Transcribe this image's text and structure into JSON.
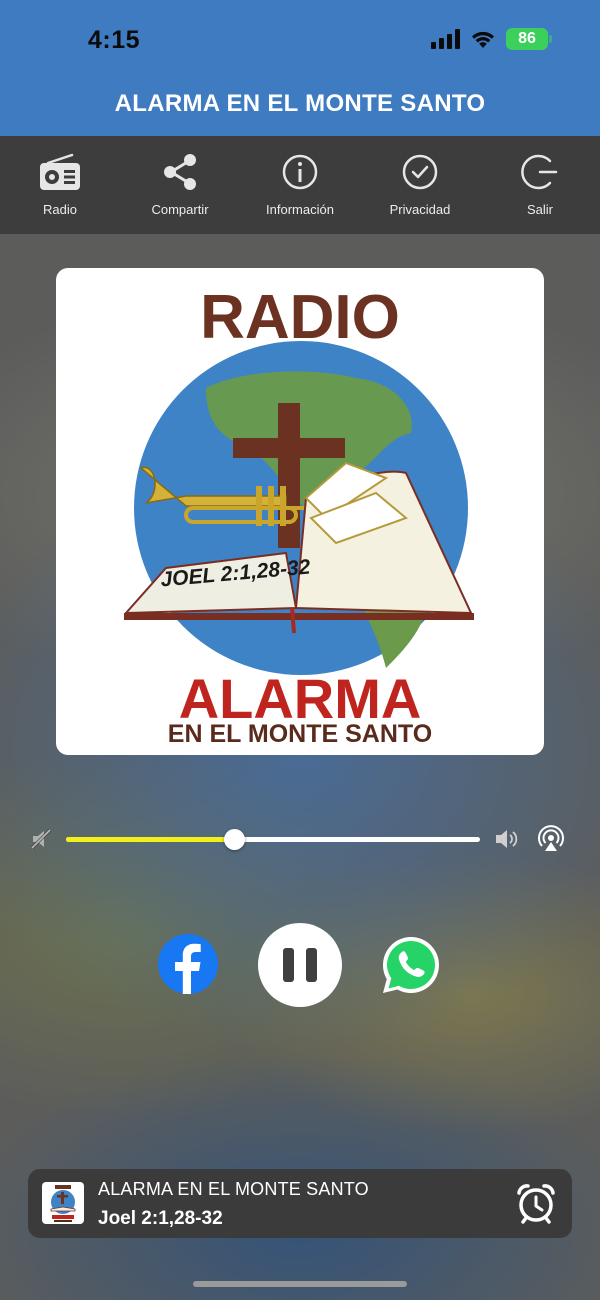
{
  "status_bar": {
    "time": "4:15",
    "battery": "86"
  },
  "app": {
    "title": "ALARMA EN EL MONTE SANTO"
  },
  "toolbar": {
    "items": [
      {
        "label": "Radio",
        "icon": "radio-icon"
      },
      {
        "label": "Compartir",
        "icon": "share-icon"
      },
      {
        "label": "Información",
        "icon": "info-icon"
      },
      {
        "label": "Privacidad",
        "icon": "check-circle-icon"
      },
      {
        "label": "Salir",
        "icon": "exit-icon"
      }
    ]
  },
  "artwork": {
    "top_text": "RADIO",
    "verse": "JOEL 2:1,28-32",
    "main_text": "ALARMA",
    "sub_text": "EN EL MONTE SANTO"
  },
  "volume": {
    "level": 0.405,
    "fill_color": "#f2ef1b"
  },
  "controls": {
    "state": "playing",
    "icons": [
      "facebook-icon",
      "pause-icon",
      "whatsapp-icon"
    ]
  },
  "now_playing": {
    "station": "ALARMA EN EL MONTE SANTO",
    "track": "Joel 2:1,28-32"
  },
  "colors": {
    "header": "#3f7bc0",
    "toolbar": "#3d3d3d",
    "accent": "#f2ef1b",
    "facebook": "#1877f2",
    "whatsapp": "#25d366"
  }
}
